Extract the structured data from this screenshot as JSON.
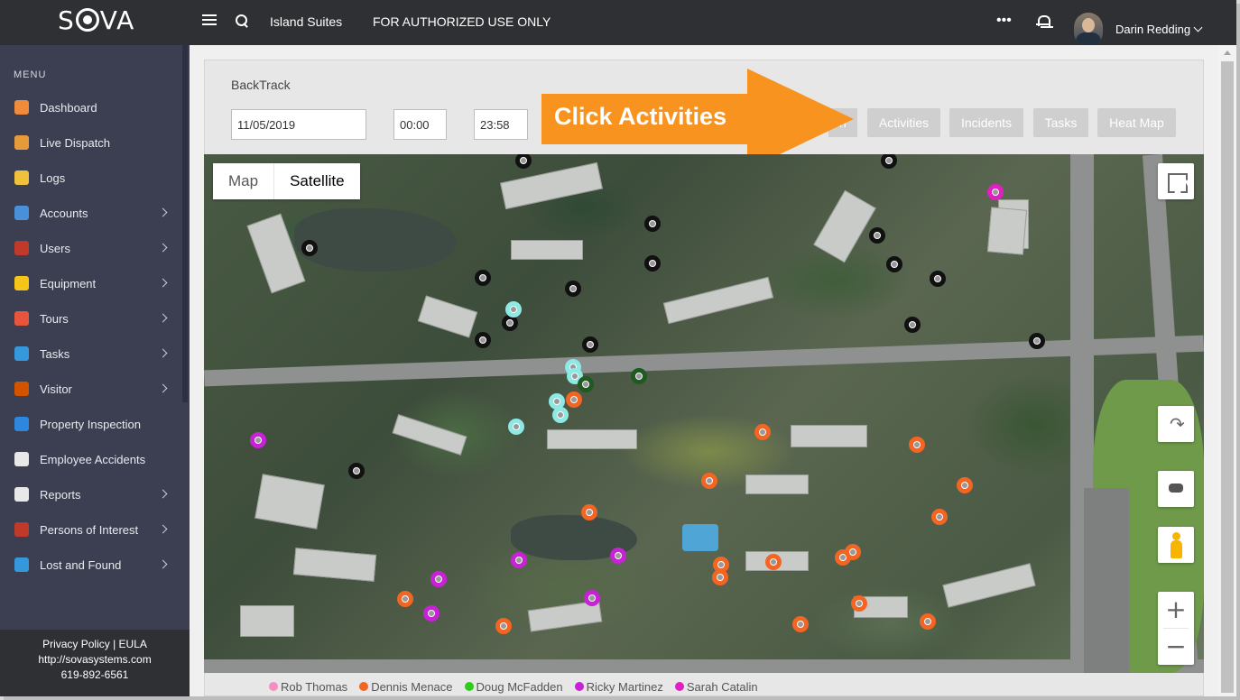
{
  "header": {
    "logo": "SOVA",
    "site_name": "Island Suites",
    "notice": "FOR AUTHORIZED USE ONLY",
    "more_icon": "more-horizontal-icon",
    "bell_icon": "bell-icon",
    "user_name": "Darin Redding"
  },
  "sidebar": {
    "menu_title": "MENU",
    "items": [
      {
        "label": "Dashboard",
        "icon": "home-icon",
        "color": "#f08b3b",
        "arrow": false
      },
      {
        "label": "Live Dispatch",
        "icon": "shield-icon",
        "color": "#e59b3c",
        "arrow": false
      },
      {
        "label": "Logs",
        "icon": "pencil-icon",
        "color": "#f0c23b",
        "arrow": false
      },
      {
        "label": "Accounts",
        "icon": "book-icon",
        "color": "#4a90d9",
        "arrow": true
      },
      {
        "label": "Users",
        "icon": "person-icon",
        "color": "#c0392b",
        "arrow": true
      },
      {
        "label": "Equipment",
        "icon": "hard-hat-icon",
        "color": "#f5c518",
        "arrow": true
      },
      {
        "label": "Tours",
        "icon": "compass-icon",
        "color": "#e8553d",
        "arrow": true
      },
      {
        "label": "Tasks",
        "icon": "gear-icon",
        "color": "#3498db",
        "arrow": true
      },
      {
        "label": "Visitor",
        "icon": "visitor-icon",
        "color": "#d35400",
        "arrow": true
      },
      {
        "label": "Property Inspection",
        "icon": "globe-icon",
        "color": "#2e86de",
        "arrow": false
      },
      {
        "label": "Employee Accidents",
        "icon": "clipboard-icon",
        "color": "#e8e8e8",
        "arrow": false
      },
      {
        "label": "Reports",
        "icon": "report-icon",
        "color": "#e8e8e8",
        "arrow": true
      },
      {
        "label": "Persons of Interest",
        "icon": "person-of-interest-icon",
        "color": "#c0392b",
        "arrow": true
      },
      {
        "label": "Lost and Found",
        "icon": "target-icon",
        "color": "#3498db",
        "arrow": true
      }
    ],
    "footer": {
      "links": "Privacy Policy | EULA",
      "url": "http://sovasystems.com",
      "phone": "619-892-6561"
    }
  },
  "backtrack": {
    "title": "BackTrack",
    "date": "11/05/2019",
    "start_time": "00:00",
    "end_time": "23:58",
    "hidden_button_label": "n",
    "buttons": [
      "Activities",
      "Incidents",
      "Tasks",
      "Heat Map"
    ]
  },
  "callout": {
    "text": "Click Activities",
    "color": "#f7931e"
  },
  "map": {
    "type_map": "Map",
    "type_satellite": "Satellite",
    "zoom_in": "+",
    "zoom_out": "−"
  },
  "legend": [
    {
      "name": "Rob Thomas",
      "color": "#f48fc1"
    },
    {
      "name": "Dennis Menace",
      "color": "#f26522"
    },
    {
      "name": "Doug McFadden",
      "color": "#2ecc1a"
    },
    {
      "name": "Ricky Martinez",
      "color": "#c822d6"
    },
    {
      "name": "Sarah Catalin",
      "color": "#e020c0"
    }
  ],
  "marker_colors": {
    "black": "#111111",
    "cyan": "#8ee8e4",
    "dark_green": "#1e5a22",
    "orange": "#f26522",
    "purple": "#c822d6",
    "magenta": "#e020c0"
  }
}
